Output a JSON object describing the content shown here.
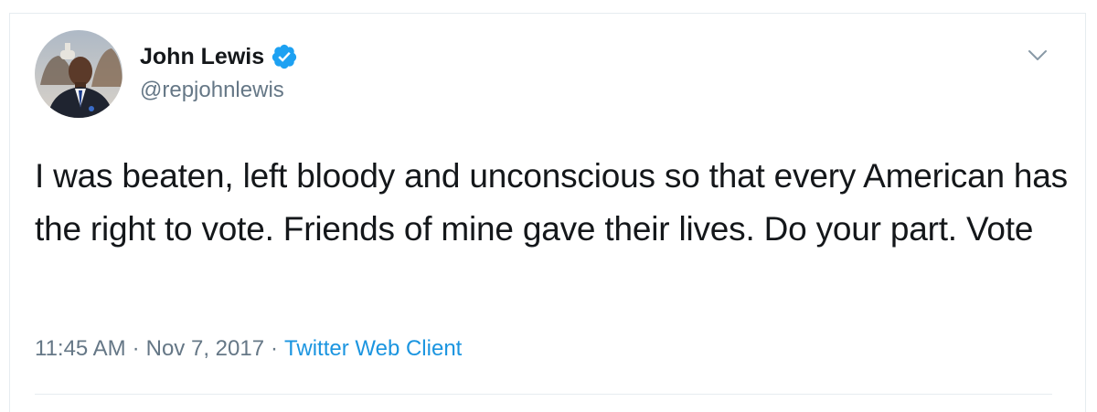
{
  "tweet": {
    "author": {
      "display_name": "John Lewis",
      "handle": "@repjohnlewis",
      "verified": true
    },
    "text": "I was beaten, left bloody and unconscious so that every American has the right to vote. Friends of mine gave their lives. Do your part. Vote",
    "time": "11:45 AM",
    "date": "Nov 7, 2017",
    "separator": "·",
    "source": "Twitter Web Client"
  },
  "icons": {
    "verified": "verified-badge-icon",
    "caret": "chevron-down-icon"
  },
  "colors": {
    "text": "#14171a",
    "secondary": "#657786",
    "link": "#1b95e0",
    "verified": "#1da1f2",
    "border": "#e6ecf0"
  }
}
